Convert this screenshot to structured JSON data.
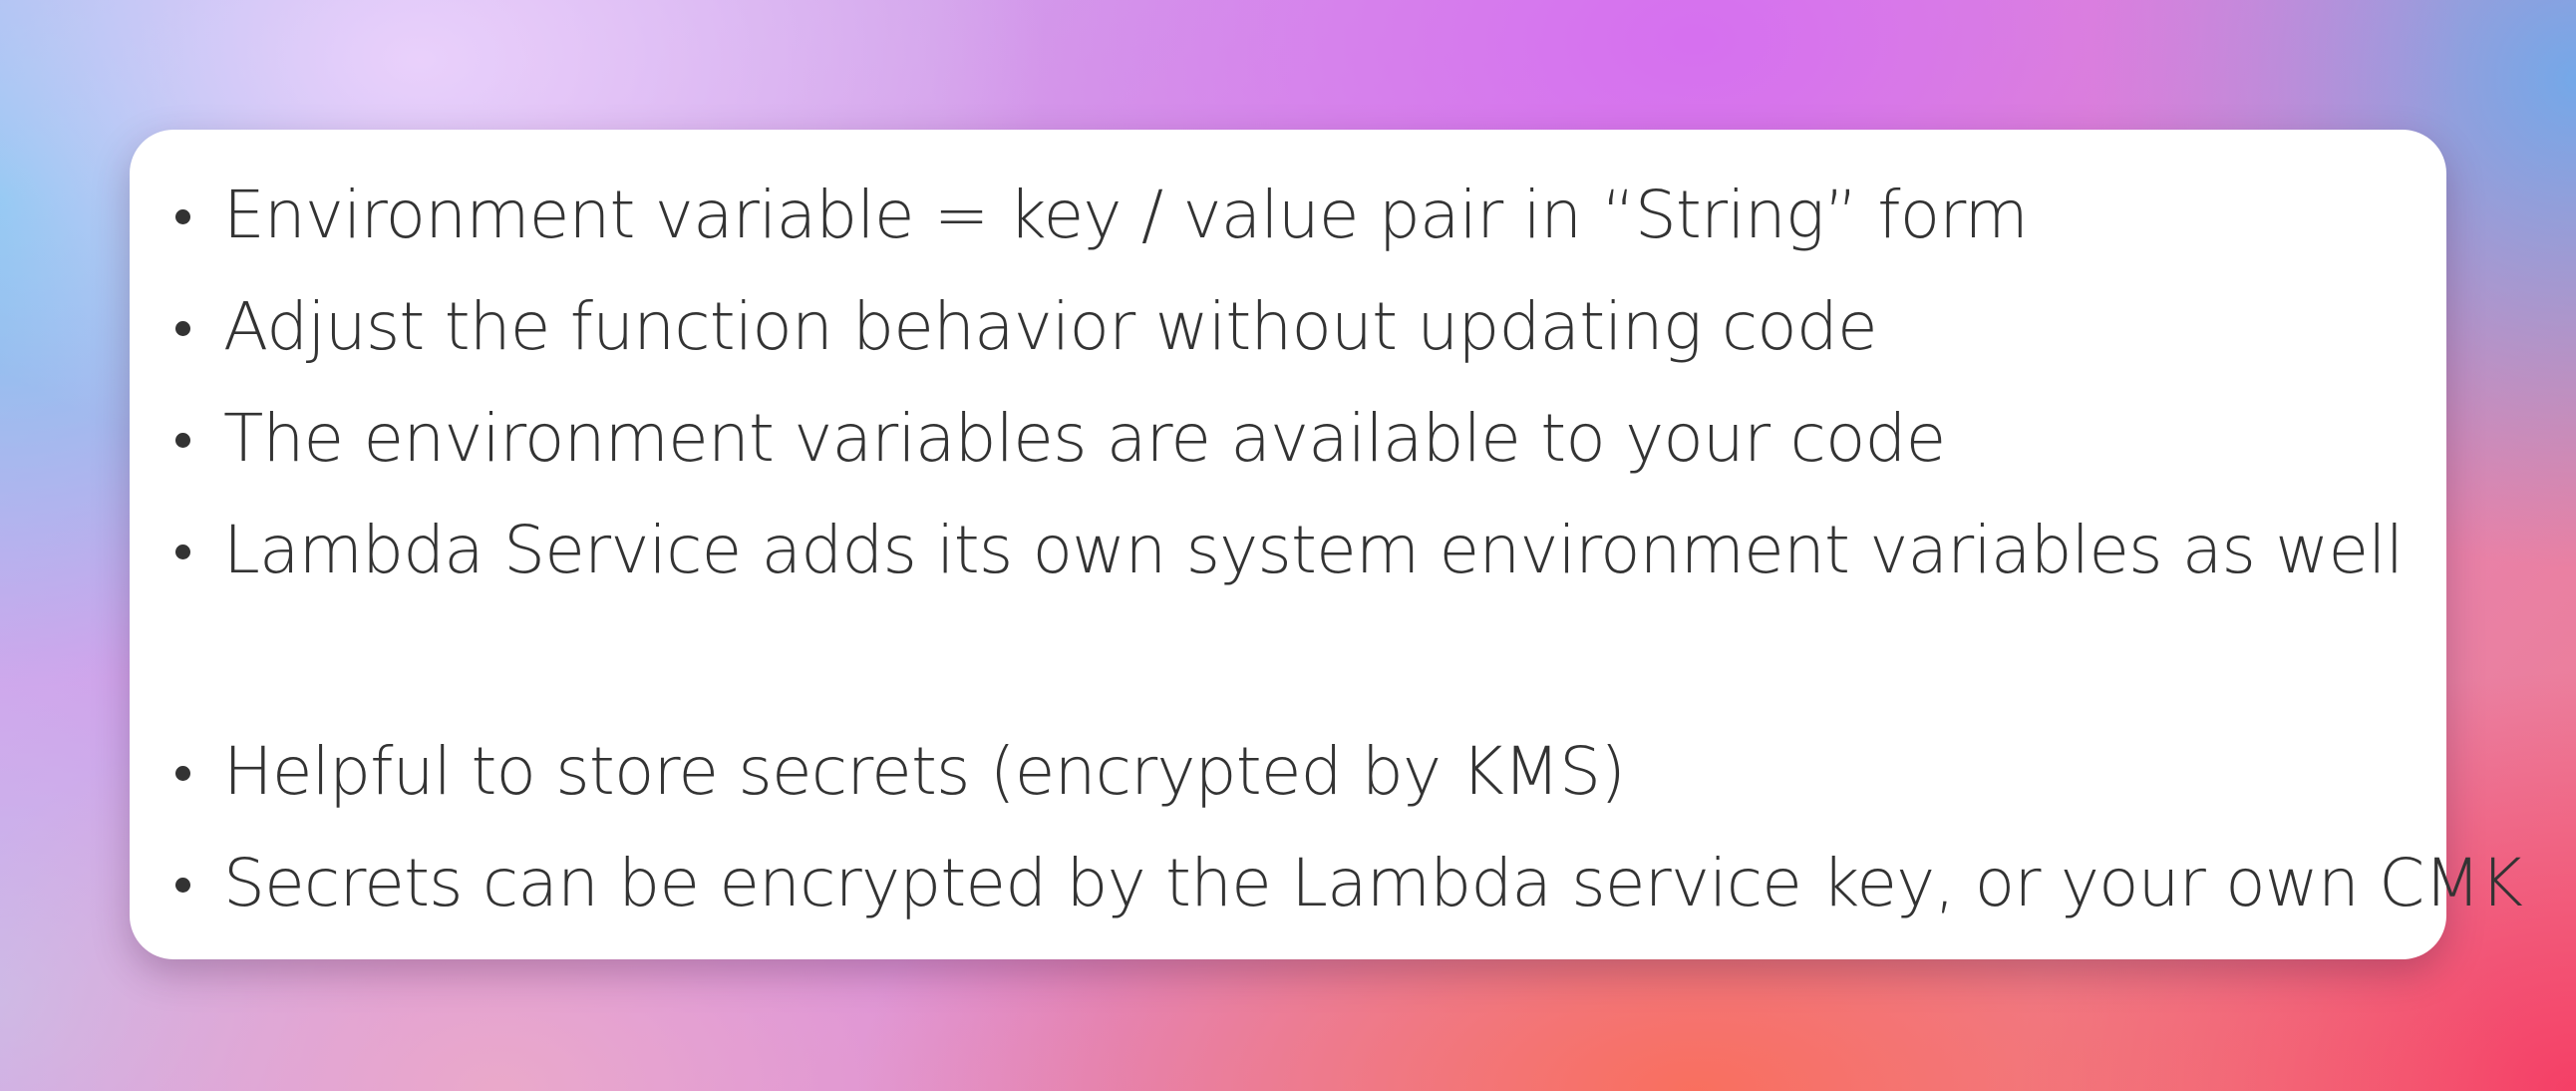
{
  "slide": {
    "bullets": [
      "Environment variable = key / value pair in “String” form",
      "Adjust the function behavior without updating code",
      "The environment variables are available to your code",
      "Lambda Service adds its own system environment variables as well",
      "Helpful to store secrets (encrypted by KMS)",
      "Secrets can be encrypted by the Lambda service key, or your own CMK"
    ]
  }
}
